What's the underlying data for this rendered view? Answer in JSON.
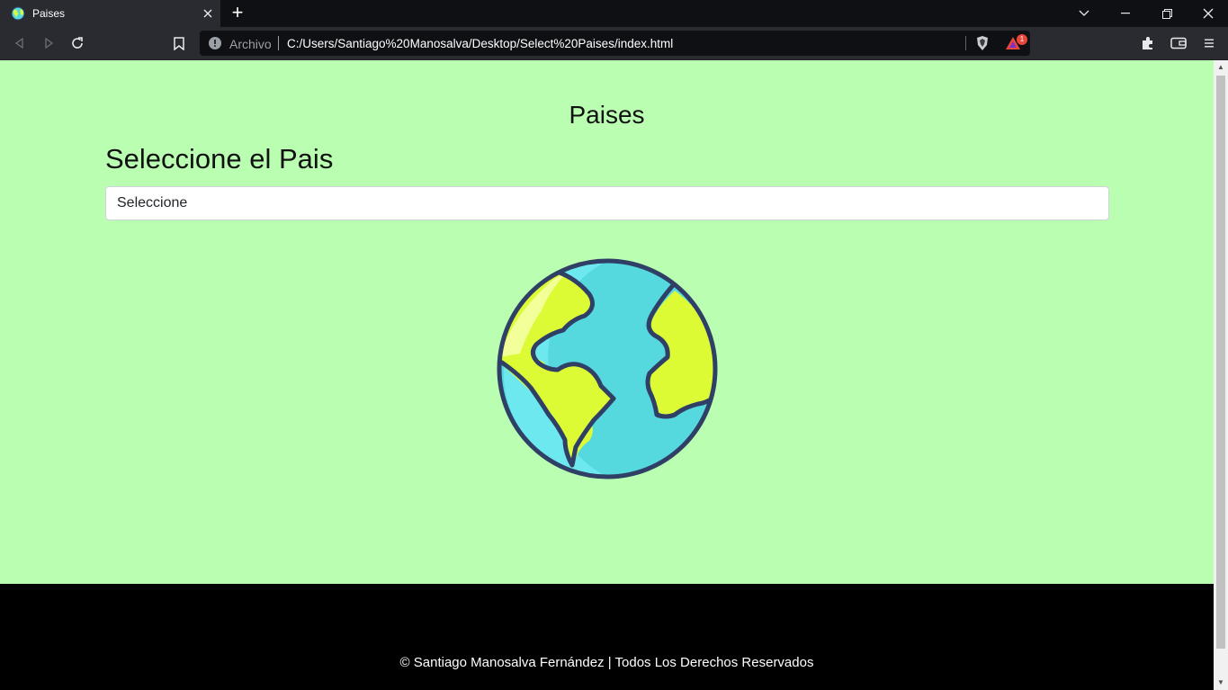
{
  "browser": {
    "tab_title": "Paises",
    "new_tab_label": "+",
    "omnibox": {
      "security_label": "Archivo",
      "url": "C:/Users/Santiago%20Manosalva/Desktop/Select%20Paises/index.html"
    },
    "rewards_badge": "1",
    "icons": [
      "back-icon",
      "forward-icon",
      "reload-icon",
      "bookmark-icon",
      "info-icon",
      "brave-shields-icon",
      "brave-rewards-icon",
      "extensions-icon",
      "wallet-icon",
      "menu-icon",
      "tab-search-icon",
      "minimize-icon",
      "restore-icon",
      "close-icon"
    ]
  },
  "page": {
    "title": "Paises",
    "subheading": "Seleccione el Pais",
    "select": {
      "selected": "Seleccione"
    },
    "illustration": "globe-icon",
    "footer": "© Santiago Manosalva Fernández | Todos Los Derechos Reservados"
  },
  "colors": {
    "page_background": "#baffb1",
    "footer_background": "#000000",
    "globe_ocean": "#55d8de",
    "globe_land": "#dcfb35",
    "globe_outline": "#2f3f66"
  }
}
